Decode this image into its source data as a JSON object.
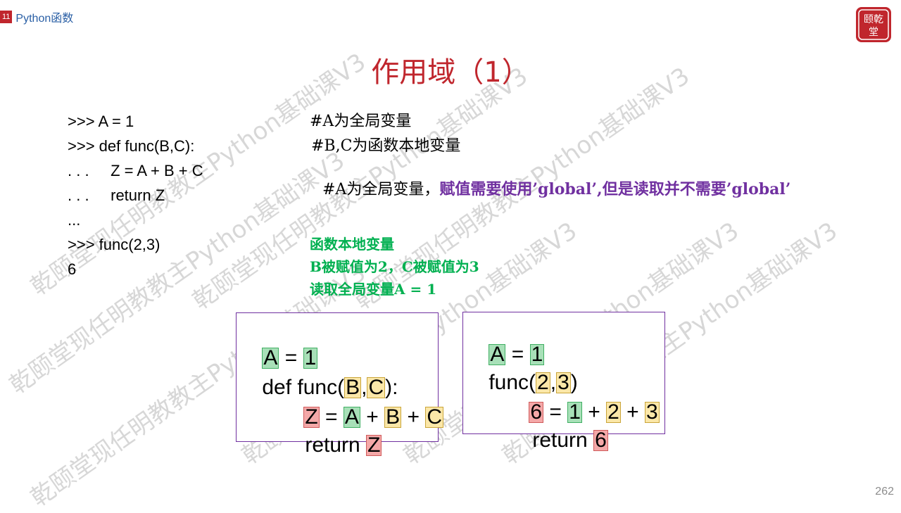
{
  "header": {
    "chapter_number": "11",
    "chapter_title": "Python函数"
  },
  "logo": {
    "text": "乾颐堂",
    "color": "#c0262d"
  },
  "slide_title": "作用域（1）",
  "code_lines": [
    ">>> A = 1",
    ">>> def func(B,C):",
    ". . .     Z = A + B + C",
    ". . .     return Z",
    "...",
    ">>> func(2,3)",
    "6"
  ],
  "comments": {
    "line1": "#A为全局变量",
    "line2": "#B,C为函数本地变量",
    "line3_black": "#A为全局变量，",
    "line3_purple": "赋值需要使用’global’,但是读取并不需要’global’"
  },
  "green_notes": [
    "函数本地变量",
    "B被赋值为2，C被赋值为3",
    "读取全局变量A = 1"
  ],
  "box_left": {
    "line1": {
      "a": "A",
      "eq": " = ",
      "one": "1"
    },
    "line2": {
      "def": "def func(",
      "b": "B",
      "comma": ",",
      "c": "C",
      "end": "):"
    },
    "line3": {
      "z": "Z",
      "eq": " = ",
      "a": "A",
      "p1": " + ",
      "b": "B",
      "p2": " + ",
      "c": "C"
    },
    "line4": {
      "ret": "return ",
      "z": "Z"
    }
  },
  "box_right": {
    "line1": {
      "a": "A",
      "eq": " = ",
      "one": "1"
    },
    "line2": {
      "func": "func(",
      "two": "2",
      "comma": ",",
      "three": "3",
      "end": ")"
    },
    "line3": {
      "six": "6",
      "eq": " = ",
      "one": "1",
      "p1": " + ",
      "two": "2",
      "p2": " + ",
      "three": "3"
    },
    "line4": {
      "ret": "return ",
      "six": "6"
    }
  },
  "watermark_text": "乾颐堂现任明教教主Python基础课V3",
  "page_number": "262",
  "colors": {
    "title_red": "#c0262d",
    "comment_purple": "#7030a0",
    "note_green": "#00b050",
    "box_border": "#7030a0",
    "highlight_green": "#a8e0b8",
    "highlight_yellow": "#fbe7a8",
    "highlight_red": "#f4a8a8"
  }
}
